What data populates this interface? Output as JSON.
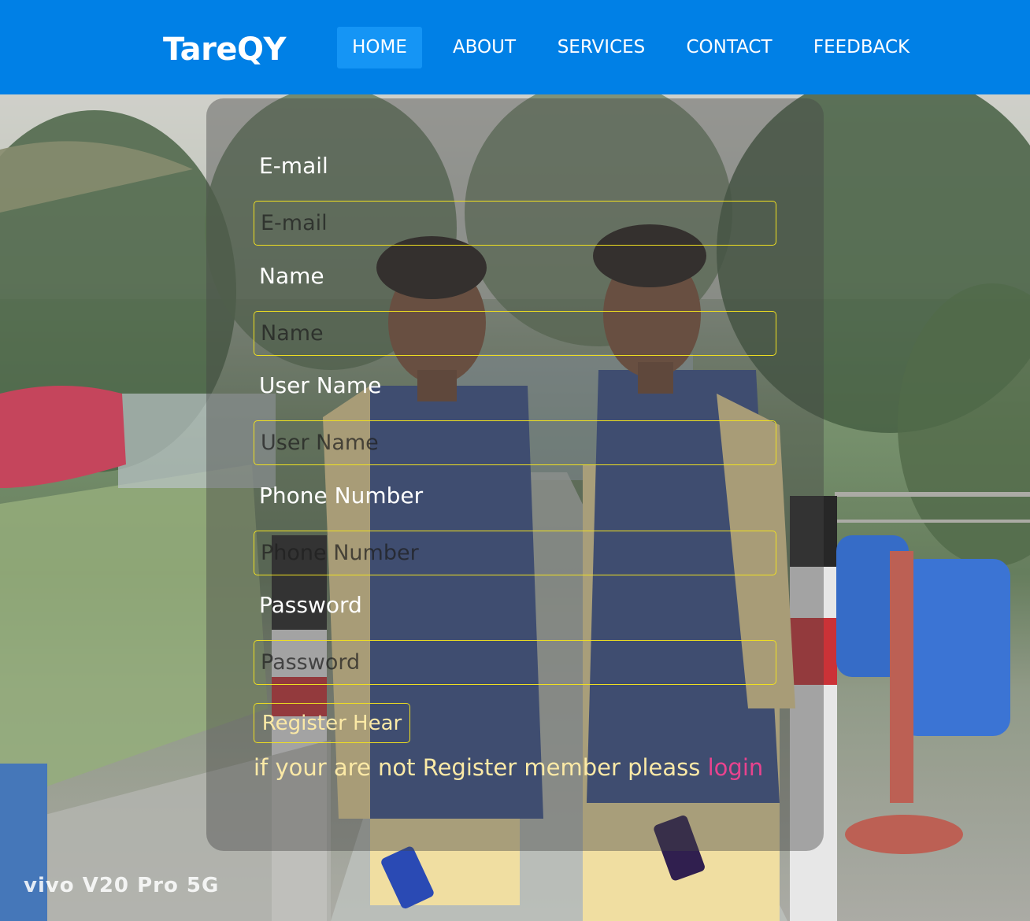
{
  "brand": "TareQY",
  "nav": {
    "items": [
      "HOME",
      "ABOUT",
      "SERVICES",
      "CONTACT",
      "FEEDBACK"
    ],
    "active": "HOME"
  },
  "form": {
    "email": {
      "label": "E-mail",
      "placeholder": "E-mail"
    },
    "name": {
      "label": "Name",
      "placeholder": "Name"
    },
    "username": {
      "label": "User Name",
      "placeholder": "User Name"
    },
    "phone": {
      "label": "Phone Number",
      "placeholder": "Phone Number"
    },
    "password": {
      "label": "Password",
      "placeholder": "Password"
    },
    "submit_label": "Register Hear",
    "note_text": "if your are not Register member pleass ",
    "login_link": "login"
  },
  "photo_watermark": "vivo V20 Pro 5G",
  "colors": {
    "navbar": "#0080e6",
    "nav_active": "#1595f5",
    "input_border": "#f0e020",
    "note_text": "#fbe9a6",
    "login_link": "#e8438e"
  }
}
